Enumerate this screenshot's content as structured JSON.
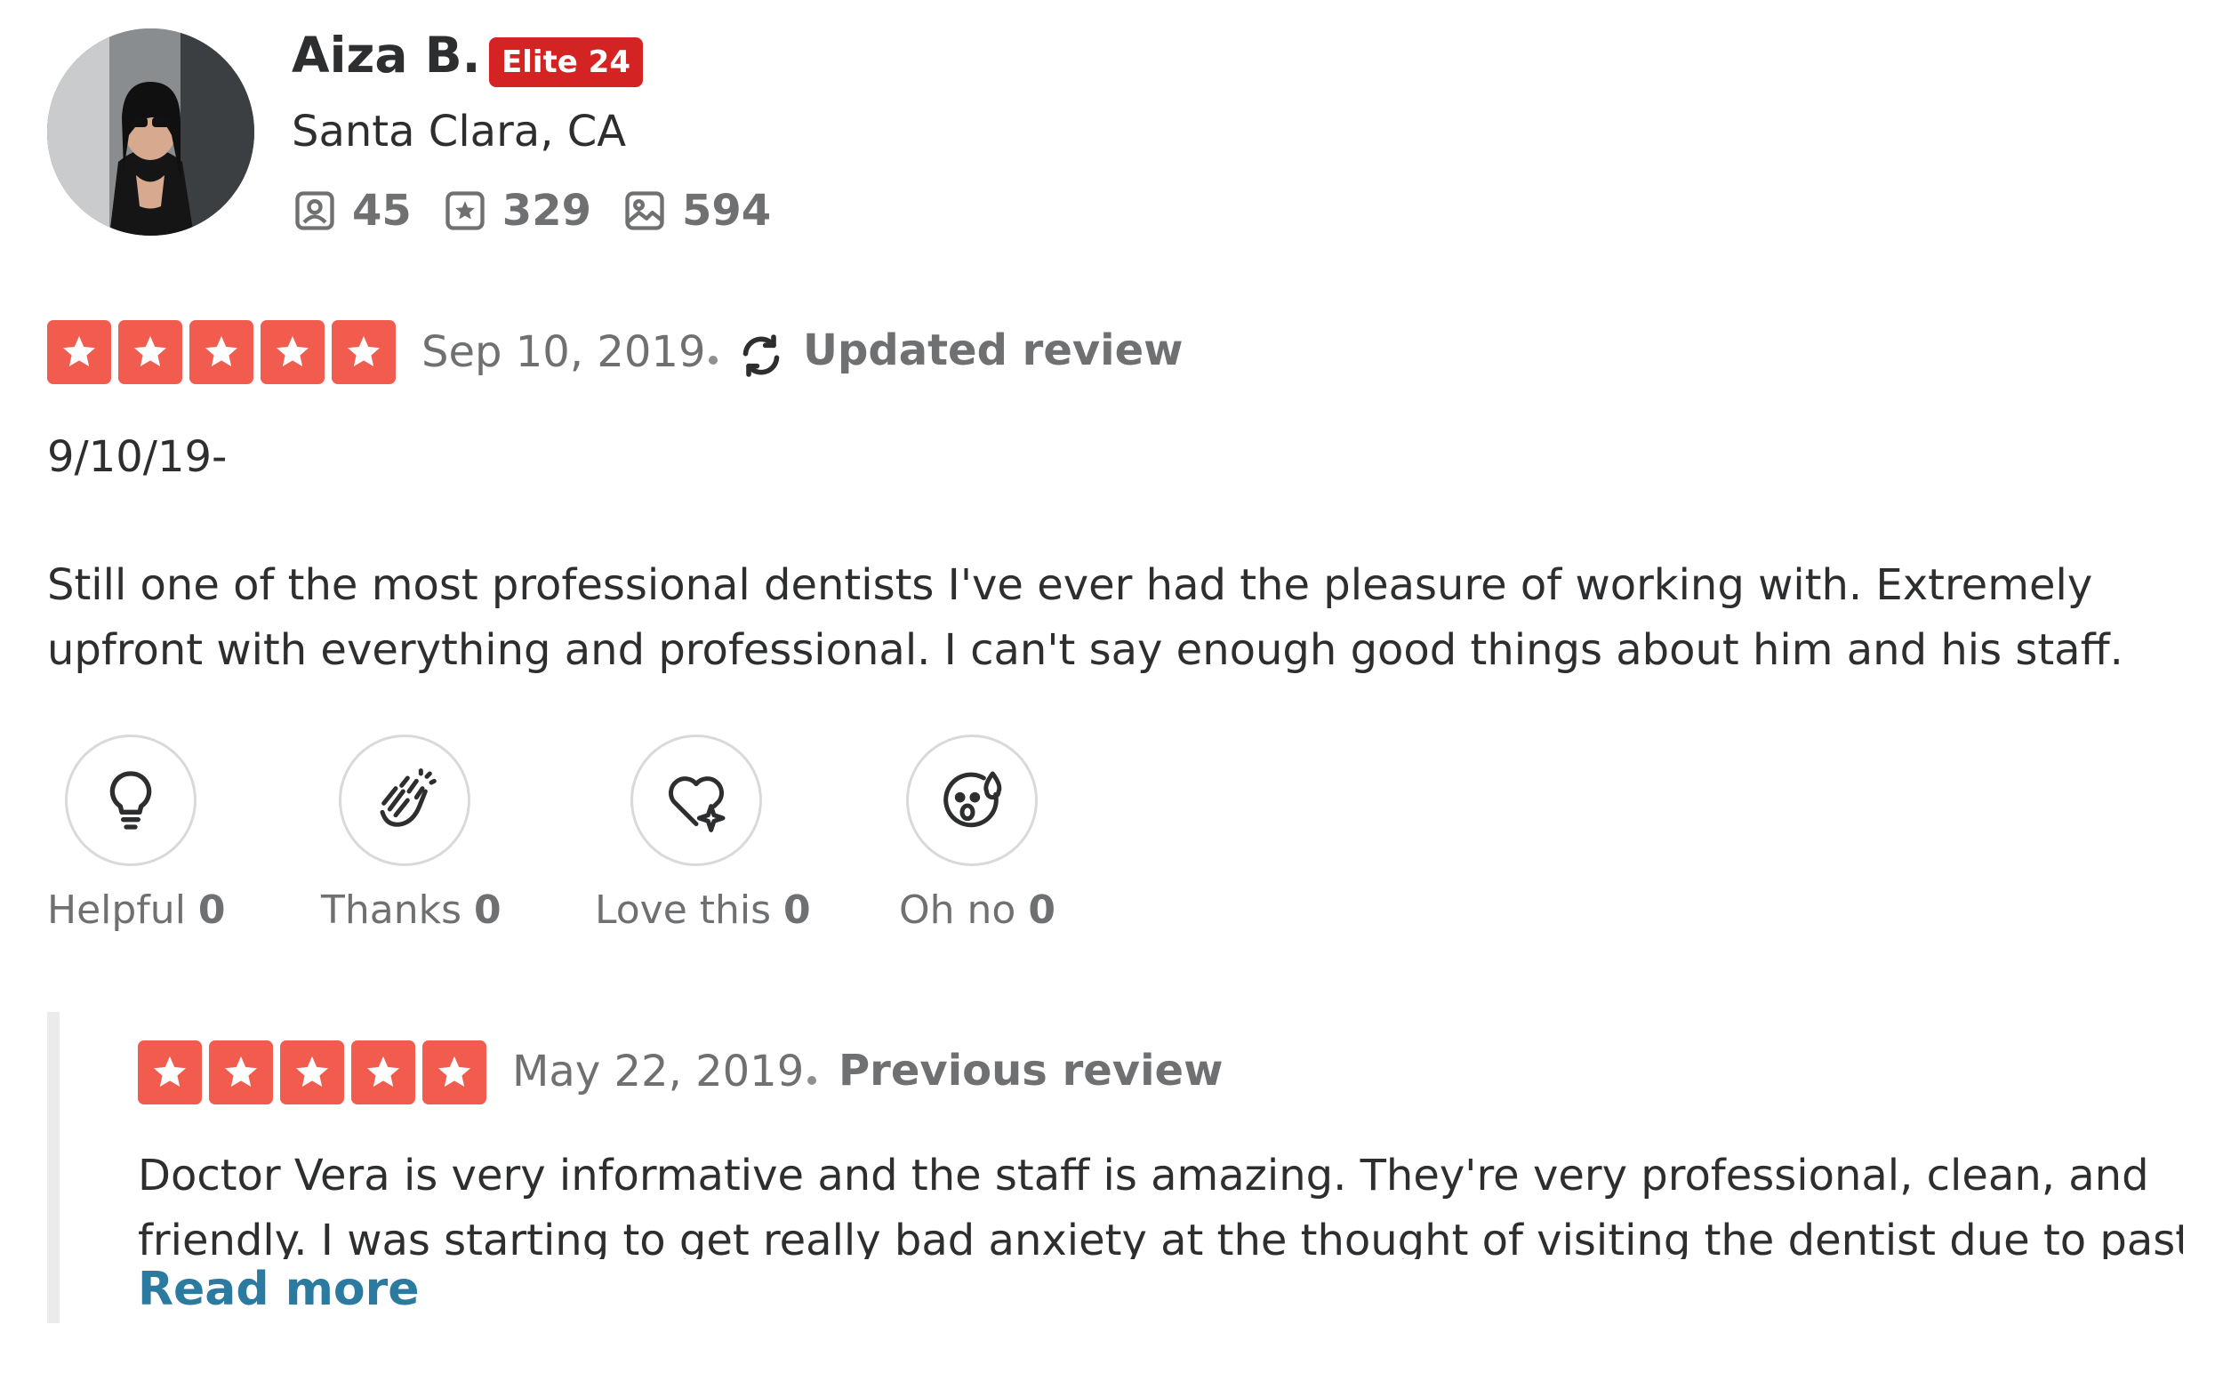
{
  "user": {
    "name": "Aiza B.",
    "elite_badge": "Elite 24",
    "location": "Santa Clara, CA",
    "stats": {
      "friends": "45",
      "reviews": "329",
      "photos": "594"
    }
  },
  "review": {
    "rating": 5,
    "date": "Sep 10, 2019",
    "status": "Updated review",
    "text_lines": [
      "9/10/19-",
      "Still one of the most professional dentists I've ever had the pleasure of working with. Extremely",
      "upfront with everything and professional. I can't say enough good things about him and his staff."
    ]
  },
  "reactions": [
    {
      "label": "Helpful",
      "count": "0",
      "icon": "lightbulb-icon"
    },
    {
      "label": "Thanks",
      "count": "0",
      "icon": "clapping-hands-icon"
    },
    {
      "label": "Love this",
      "count": "0",
      "icon": "heart-sparkle-icon"
    },
    {
      "label": "Oh no",
      "count": "0",
      "icon": "shocked-face-icon"
    }
  ],
  "previous_review": {
    "rating": 5,
    "date": "May 22, 2019",
    "status": "Previous review",
    "text_lines": [
      "Doctor Vera is very informative and the staff is amazing. They're very professional, clean, and",
      "friendly. I was starting to get really bad anxiety at the thought of visiting the dentist due to past..."
    ],
    "read_more": "Read more"
  },
  "colors": {
    "star_red": "#f15c4f",
    "elite_red": "#d32323",
    "link_blue": "#2b7aa0"
  }
}
